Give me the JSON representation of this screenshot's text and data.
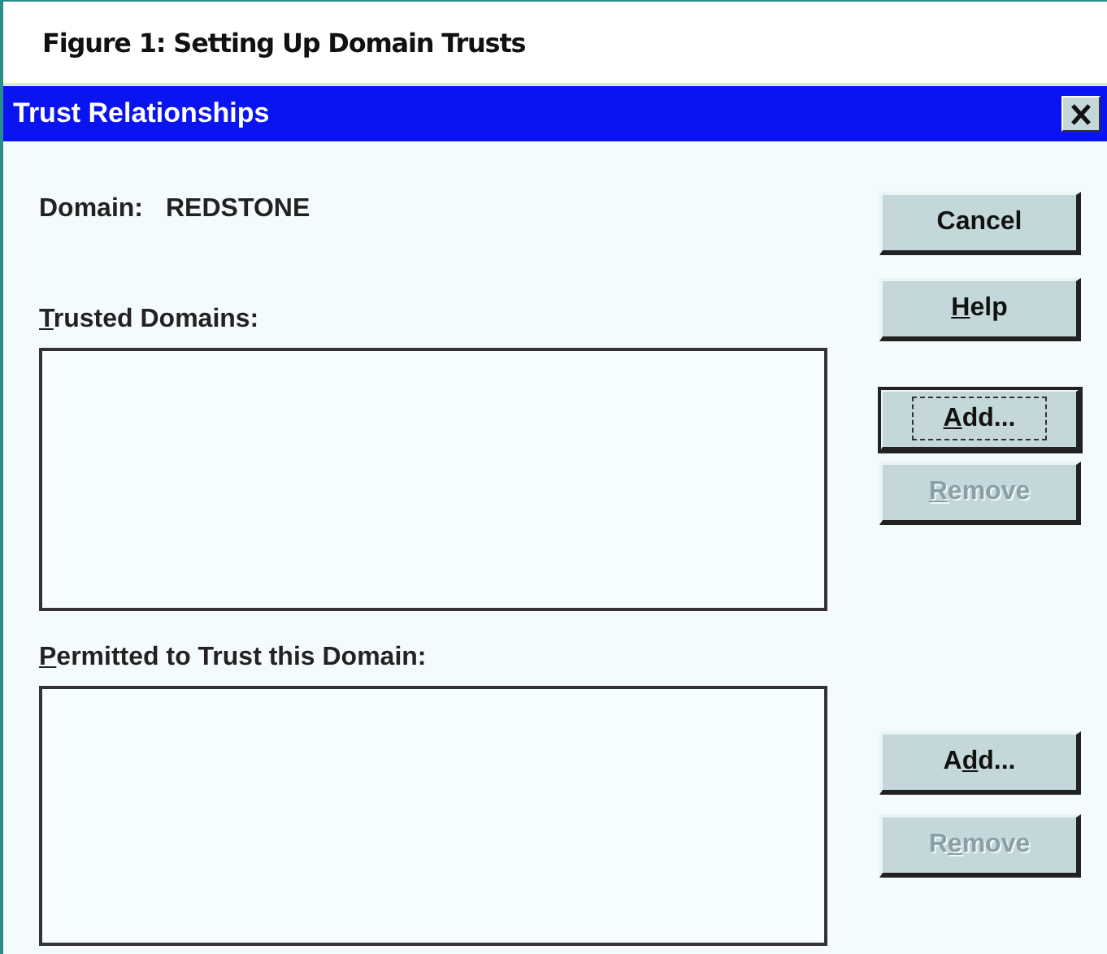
{
  "figure": {
    "caption": "Figure 1: Setting Up Domain Trusts"
  },
  "dialog": {
    "title": "Trust Relationships",
    "domain": {
      "label": "Domain:",
      "value": "REDSTONE"
    },
    "buttons": [
      {
        "parts": [
          {
            "text": "Cancel",
            "underline": false
          }
        ],
        "focused": false,
        "disabled": false
      },
      {
        "parts": [
          {
            "text": "H",
            "underline": true
          },
          {
            "text": "elp",
            "underline": false
          }
        ],
        "focused": false,
        "disabled": false
      }
    ],
    "sections": [
      {
        "label": [
          {
            "text": "T",
            "underline": true
          },
          {
            "text": "rusted Domains:",
            "underline": false
          }
        ],
        "buttons": [
          {
            "parts": [
              {
                "text": "A",
                "underline": true
              },
              {
                "text": "dd...",
                "underline": false
              }
            ],
            "focused": true,
            "disabled": false
          },
          {
            "parts": [
              {
                "text": "R",
                "underline": true
              },
              {
                "text": "emove",
                "underline": false
              }
            ],
            "focused": false,
            "disabled": true
          }
        ]
      },
      {
        "label": [
          {
            "text": "P",
            "underline": true
          },
          {
            "text": "ermitted to Trust this Domain:",
            "underline": false
          }
        ],
        "buttons": [
          {
            "parts": [
              {
                "text": "A",
                "underline": false
              },
              {
                "text": "d",
                "underline": true
              },
              {
                "text": "d...",
                "underline": false
              }
            ],
            "focused": false,
            "disabled": false
          },
          {
            "parts": [
              {
                "text": "R",
                "underline": false
              },
              {
                "text": "e",
                "underline": true
              },
              {
                "text": "move",
                "underline": false
              }
            ],
            "focused": false,
            "disabled": true
          }
        ]
      }
    ]
  }
}
